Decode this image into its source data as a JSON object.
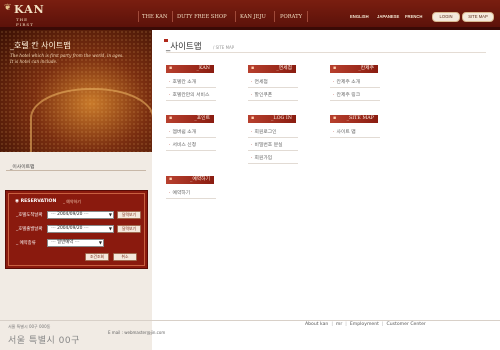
{
  "header": {
    "logo_text": "KAN",
    "logo_sub": "THE FIRST",
    "nav": [
      "THE KAN",
      "DUTY FREE SHOP",
      "KAN JEJU",
      "PORATY"
    ],
    "languages": [
      "ENGLISH",
      "JAPANESE",
      "FRENCH"
    ],
    "login_label": "LOGIN",
    "sitemap_label": "SITE MAP"
  },
  "banner": {
    "title": "_호텔 칸 사이트맵",
    "subtitle": "The hotel which is first party from the world, in ages. It is hotel can include."
  },
  "sidebar": {
    "label": "_이사이트맵"
  },
  "reservation": {
    "title": "RESERVATION",
    "title2": "_ 예약하기",
    "checkin_label": "_호텔도착날짜",
    "checkin_value": "2004/09/20",
    "checkin_btn": "달력보기",
    "checkout_label": "_호텔출발날짜",
    "checkout_value": "2004/09/20",
    "checkout_btn": "달력보기",
    "room_label": "_ 예약종류",
    "room_value": "일반예약",
    "submit_btn": "조건조회",
    "cancel_btn": "취소"
  },
  "content": {
    "title": "_사이트맵",
    "title_en": "/ SITE MAP",
    "categories": [
      {
        "name": "_KAN",
        "items": [
          "호텔칸 소개",
          "호텔칸만의 서비스"
        ]
      },
      {
        "name": "_면세점",
        "items": [
          "면세점",
          "할인쿠폰"
        ]
      },
      {
        "name": "_칸제주",
        "items": [
          "칸제주 소개",
          "칸제주 링크"
        ]
      },
      {
        "name": "_포인트",
        "items": [
          "멤버쉽 소개",
          "서비스 신청"
        ]
      },
      {
        "name": "_LOG IN",
        "items": [
          "회원로그인",
          "비밀번호 분실",
          "회원가입"
        ]
      },
      {
        "name": "_SITE MAP",
        "items": [
          "사이트 맵"
        ]
      },
      {
        "name": "_예약하기",
        "items": [
          "예약하기"
        ]
      }
    ]
  },
  "footer": {
    "address": "서울 특별시 00구 000동",
    "watermark": "서울 특별시 00구",
    "mail": "E mail : webmaster@jin.com",
    "links": [
      "About kan",
      "mr",
      "Employment",
      "Customer Center"
    ]
  },
  "colors": {
    "header_bg": "#6b1a0e",
    "accent_red": "#8a1c10",
    "left_panel_bg": "#f1ebe4"
  }
}
